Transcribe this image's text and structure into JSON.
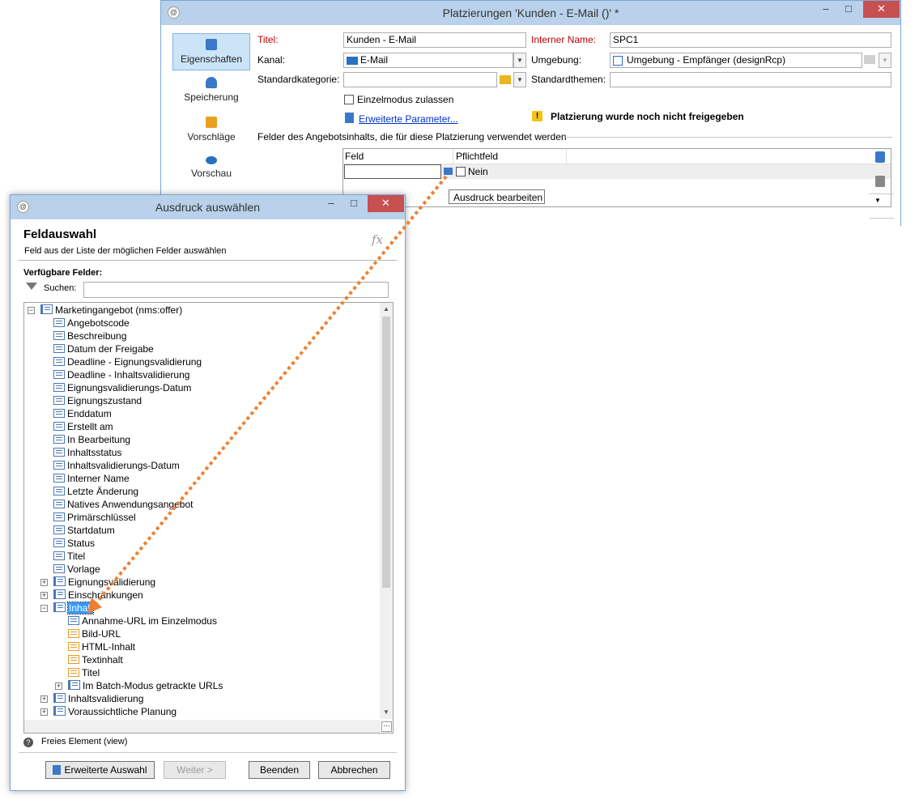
{
  "placement_window": {
    "title": "Platzierungen 'Kunden - E-Mail ()' *",
    "nav": [
      {
        "label": "Eigenschaften",
        "icon": "clipboard-icon"
      },
      {
        "label": "Speicherung",
        "icon": "database-icon"
      },
      {
        "label": "Vorschläge",
        "icon": "gift-icon"
      },
      {
        "label": "Vorschau",
        "icon": "eye-icon"
      }
    ],
    "form": {
      "titel_label": "Titel:",
      "titel_value": "Kunden - E-Mail",
      "interner_name_label": "Interner Name:",
      "interner_name_value": "SPC1",
      "kanal_label": "Kanal:",
      "kanal_value": "E-Mail",
      "umgebung_label": "Umgebung:",
      "umgebung_value": "Umgebung - Empfänger (designRcp)",
      "standardkategorie_label": "Standardkategorie:",
      "standardkategorie_value": "",
      "standardthemen_label": "Standardthemen:",
      "standardthemen_value": "",
      "einzelmodus_label": "Einzelmodus zulassen",
      "erweiterte_parameter_link": "Erweiterte Parameter...",
      "warning_text": "Platzierung wurde noch nicht freigegeben",
      "section_label": "Felder des Angebotsinhalts, die für diese Platzierung verwendet werden"
    },
    "grid": {
      "columns": [
        "Feld",
        "Pflichtfeld"
      ],
      "row": {
        "feld": "",
        "pflichtfeld": "Nein"
      }
    },
    "tooltip": "Ausdruck bearbeiten"
  },
  "expression_dialog": {
    "title": "Ausdruck auswählen",
    "heading": "Feldauswahl",
    "subheading": "Feld aus der Liste der möglichen Felder auswählen",
    "fx_label": "fx",
    "available_label": "Verfügbare Felder:",
    "search_label": "Suchen:",
    "search_value": "",
    "tree": [
      {
        "label": "Marketingangebot (nms:offer)",
        "level": 0,
        "type": "root",
        "expander": "⊟"
      },
      {
        "label": "Angebotscode",
        "level": 1,
        "type": "field"
      },
      {
        "label": "Beschreibung",
        "level": 1,
        "type": "field"
      },
      {
        "label": "Datum der Freigabe",
        "level": 1,
        "type": "field"
      },
      {
        "label": "Deadline - Eignungsvalidierung",
        "level": 1,
        "type": "field"
      },
      {
        "label": "Deadline - Inhaltsvalidierung",
        "level": 1,
        "type": "field"
      },
      {
        "label": "Eignungsvalidierungs-Datum",
        "level": 1,
        "type": "field"
      },
      {
        "label": "Eignungszustand",
        "level": 1,
        "type": "field"
      },
      {
        "label": "Enddatum",
        "level": 1,
        "type": "field"
      },
      {
        "label": "Erstellt am",
        "level": 1,
        "type": "field"
      },
      {
        "label": "In Bearbeitung",
        "level": 1,
        "type": "field"
      },
      {
        "label": "Inhaltsstatus",
        "level": 1,
        "type": "field"
      },
      {
        "label": "Inhaltsvalidierungs-Datum",
        "level": 1,
        "type": "field"
      },
      {
        "label": "Interner Name",
        "level": 1,
        "type": "field"
      },
      {
        "label": "Letzte Änderung",
        "level": 1,
        "type": "field"
      },
      {
        "label": "Natives Anwendungsangebot",
        "level": 1,
        "type": "field"
      },
      {
        "label": "Primärschlüssel",
        "level": 1,
        "type": "field"
      },
      {
        "label": "Startdatum",
        "level": 1,
        "type": "field"
      },
      {
        "label": "Status",
        "level": 1,
        "type": "field"
      },
      {
        "label": "Titel",
        "level": 1,
        "type": "field"
      },
      {
        "label": "Vorlage",
        "level": 1,
        "type": "field"
      },
      {
        "label": "Eignungsvalidierung",
        "level": 1,
        "type": "node",
        "expander": "⊞"
      },
      {
        "label": "Einschränkungen",
        "level": 1,
        "type": "node",
        "expander": "⊞"
      },
      {
        "label": "Inhalt",
        "level": 1,
        "type": "node",
        "expander": "⊟",
        "selected": true
      },
      {
        "label": "Annahme-URL im Einzelmodus",
        "level": 2,
        "type": "field"
      },
      {
        "label": "Bild-URL",
        "level": 2,
        "type": "field-orange"
      },
      {
        "label": "HTML-Inhalt",
        "level": 2,
        "type": "field-orange"
      },
      {
        "label": "Textinhalt",
        "level": 2,
        "type": "field-orange"
      },
      {
        "label": "Titel",
        "level": 2,
        "type": "field-orange"
      },
      {
        "label": "Im Batch-Modus getrackte URLs",
        "level": 2,
        "type": "node",
        "expander": "⊞"
      },
      {
        "label": "Inhaltsvalidierung",
        "level": 1,
        "type": "node",
        "expander": "⊞"
      },
      {
        "label": "Voraussichtliche Planung",
        "level": 1,
        "type": "node",
        "expander": "⊞"
      }
    ],
    "status_text": "Freies Element  (view)",
    "buttons": {
      "advanced": "Erweiterte Auswahl",
      "next": "Weiter >",
      "finish": "Beenden",
      "cancel": "Abbrechen"
    }
  },
  "colors": {
    "titlebar": "#b9d1ea",
    "selection": "#3399ff",
    "arrow": "#f08030",
    "required": "#c00000"
  }
}
